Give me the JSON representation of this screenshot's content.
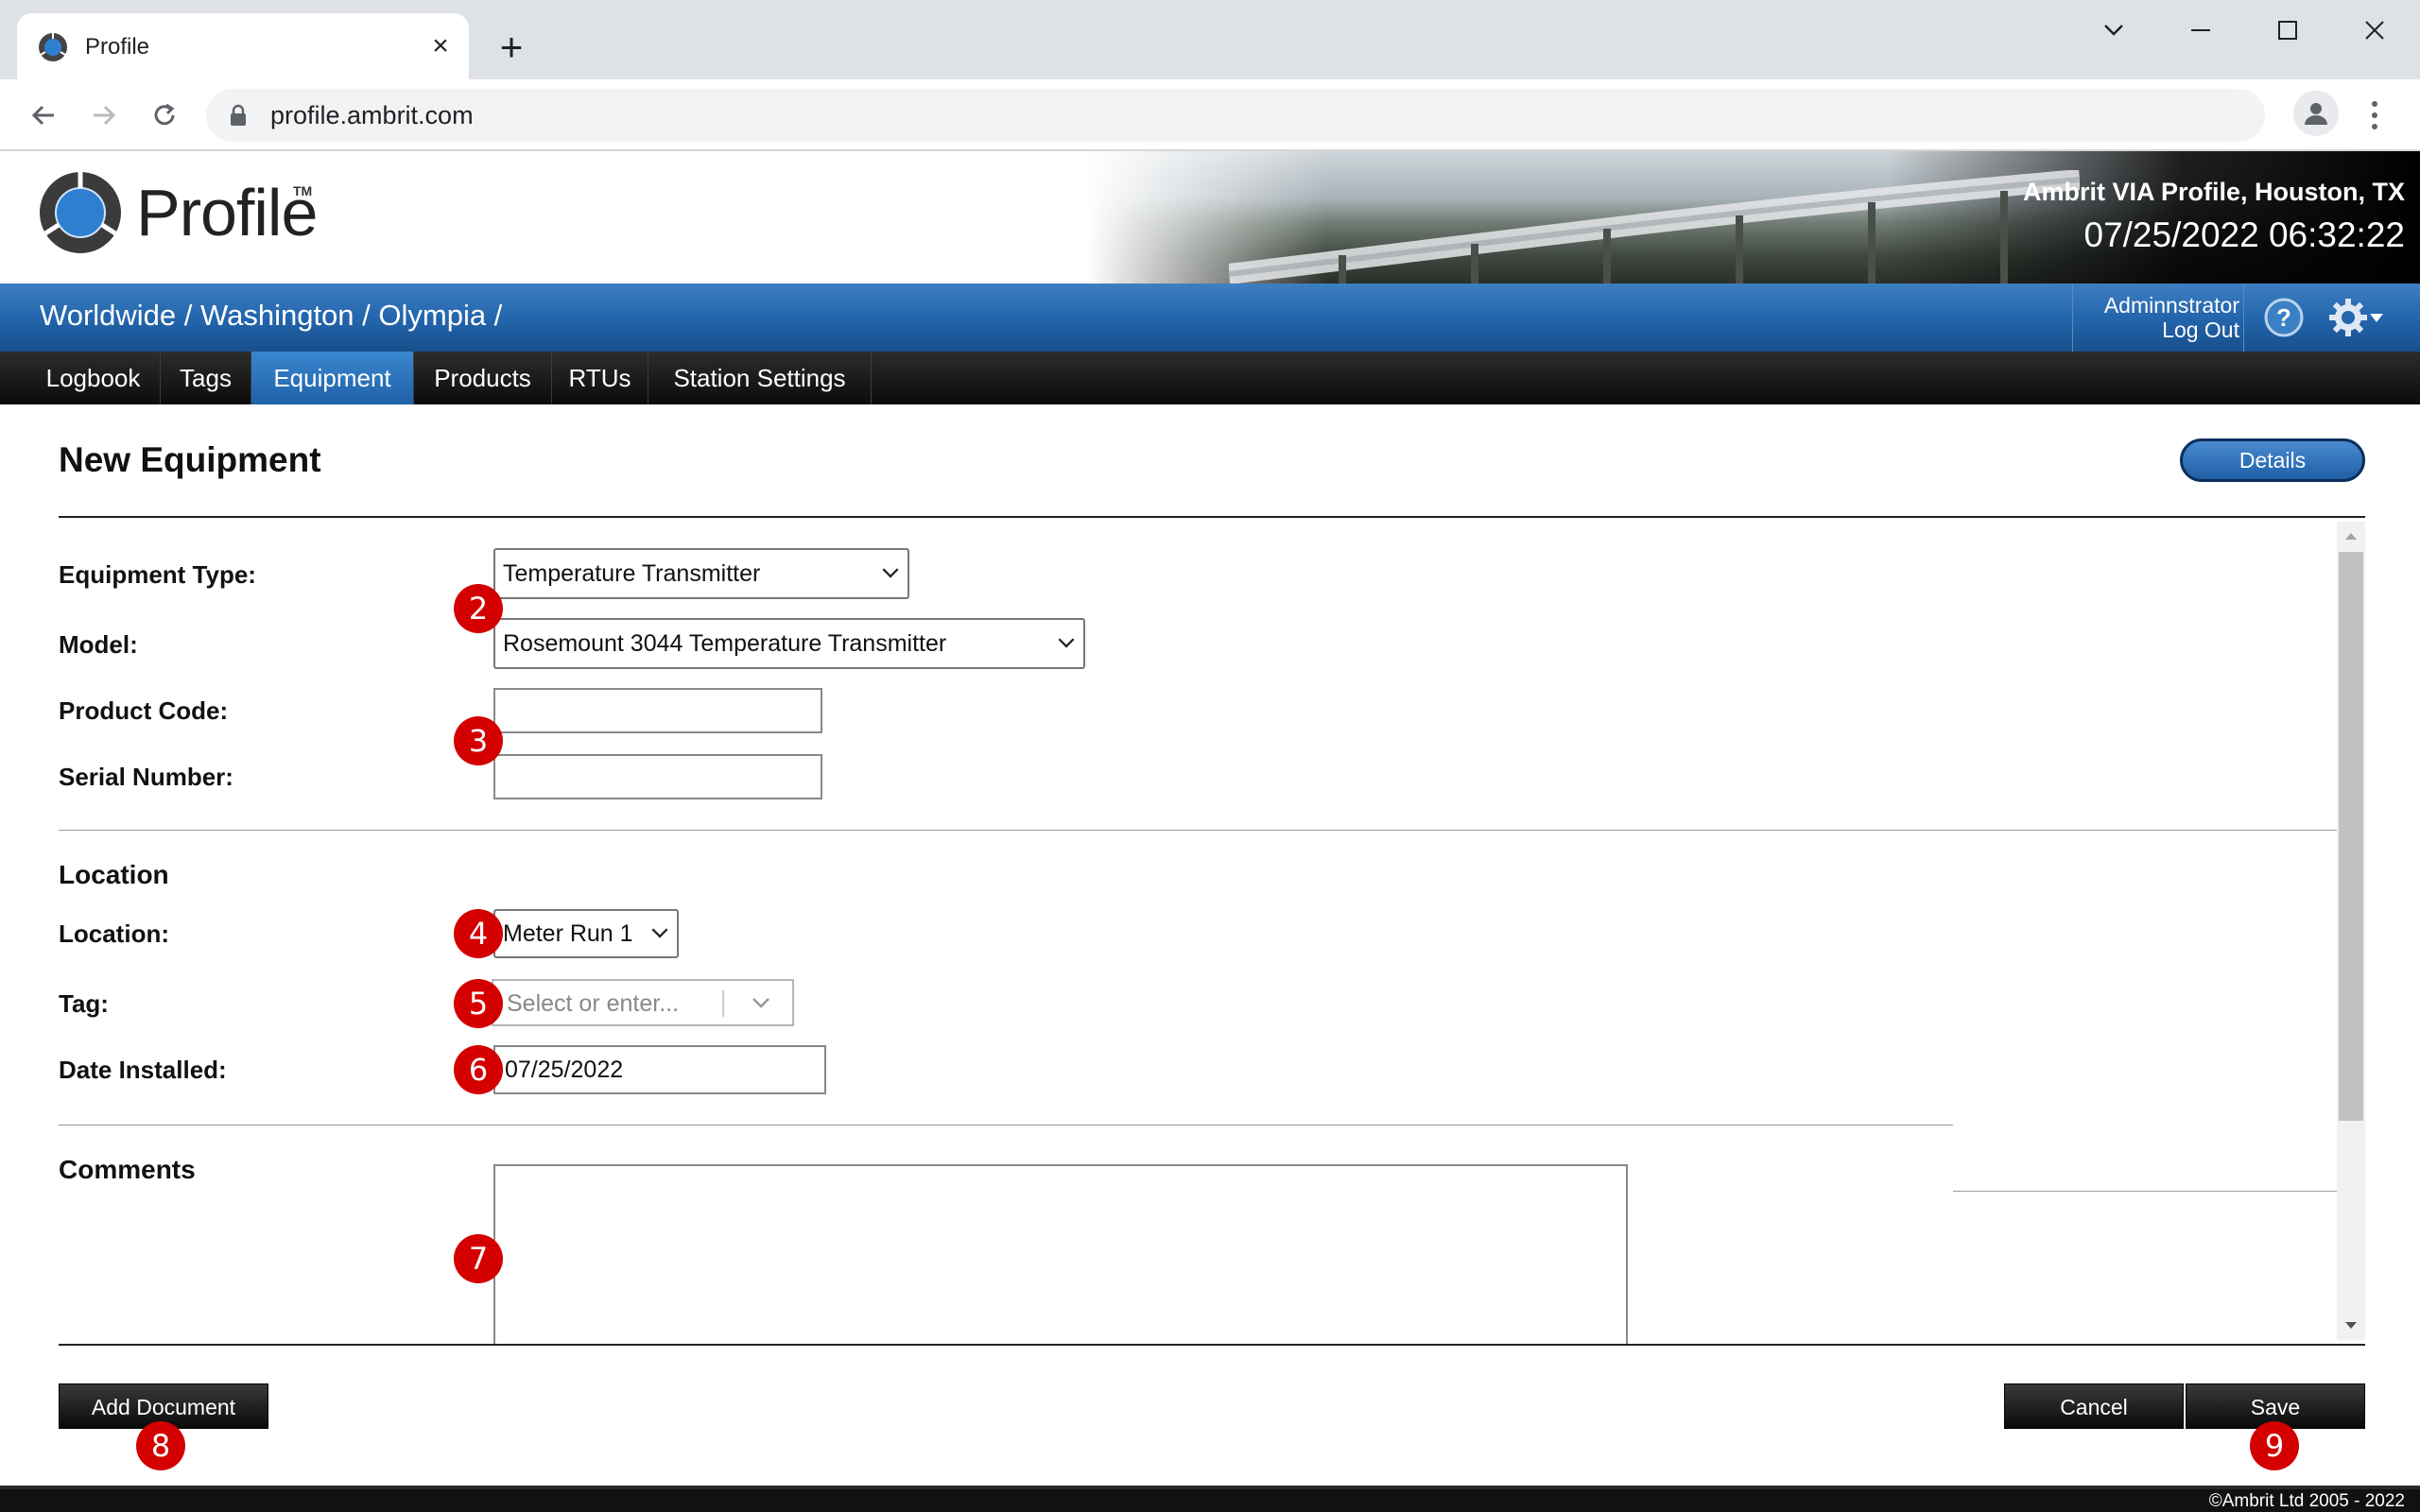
{
  "browser": {
    "tab_title": "Profile",
    "url": "profile.ambrit.com"
  },
  "header": {
    "logo_text": "Profile",
    "logo_tm": "TM",
    "site_name": "Ambrit VIA Profile, Houston, TX",
    "clock": "07/25/2022 06:32:22"
  },
  "breadcrumb": {
    "text": "Worldwide / Washington / Olympia /"
  },
  "user": {
    "name": "Adminnstrator",
    "logout_label": "Log Out"
  },
  "nav": {
    "items": [
      "Logbook",
      "Tags",
      "Equipment",
      "Products",
      "RTUs",
      "Station Settings"
    ],
    "active": "Equipment"
  },
  "page": {
    "title": "New Equipment",
    "details_label": "Details"
  },
  "form": {
    "equipment_type_label": "Equipment Type:",
    "equipment_type_value": "Temperature Transmitter",
    "model_label": "Model:",
    "model_value": "Rosemount 3044 Temperature Transmitter",
    "product_code_label": "Product Code:",
    "product_code_value": "",
    "serial_number_label": "Serial Number:",
    "serial_number_value": "",
    "location_section": "Location",
    "location_label": "Location:",
    "location_value": "Meter Run 1",
    "tag_label": "Tag:",
    "tag_placeholder": "Select or enter...",
    "date_installed_label": "Date Installed:",
    "date_installed_value": "07/25/2022",
    "comments_section": "Comments",
    "comments_value": ""
  },
  "markers": [
    "2",
    "3",
    "4",
    "5",
    "6",
    "7",
    "8",
    "9"
  ],
  "buttons": {
    "add_document": "Add Document",
    "cancel": "Cancel",
    "save": "Save"
  },
  "footer": {
    "copyright": "©Ambrit Ltd 2005 - 2022"
  },
  "colors": {
    "brand_blue": "#2466ad",
    "nav_active": "#1f62a8",
    "marker_red": "#d40000"
  }
}
